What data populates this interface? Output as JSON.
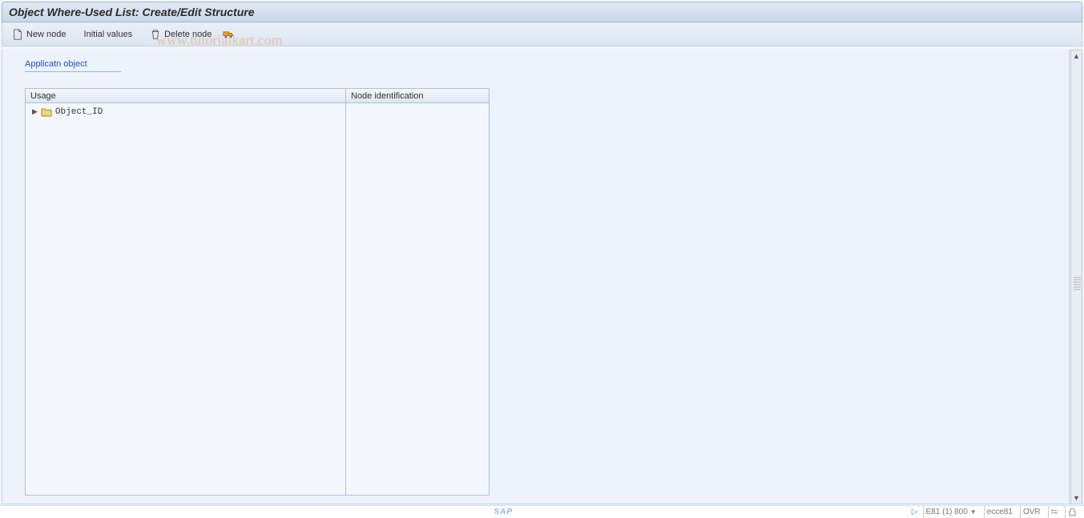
{
  "header": {
    "title": "Object Where-Used List: Create/Edit Structure"
  },
  "toolbar": {
    "new_node": "New node",
    "initial_values": "Initial values",
    "delete_node": "Delete node"
  },
  "content": {
    "app_link": "Applicatn object"
  },
  "tree": {
    "col_usage": "Usage",
    "col_nodeid": "Node identification",
    "items": [
      {
        "label": "Object_ID"
      }
    ]
  },
  "statusbar": {
    "sap_logo": "SAP",
    "system": "E81 (1) 800",
    "server": "ecce81",
    "mode": "OVR"
  },
  "watermark": "www.tutorialkart.com"
}
